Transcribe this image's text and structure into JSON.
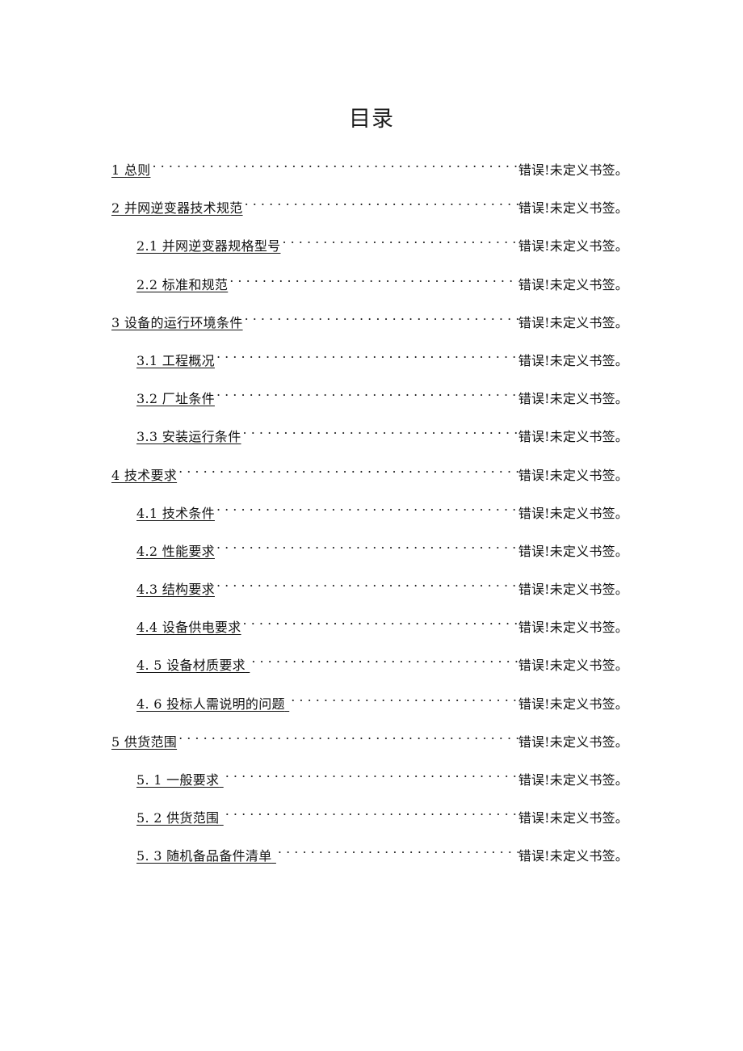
{
  "document": {
    "title": "目录",
    "page_background": "#ffffff",
    "text_color": "#111111"
  },
  "toc": {
    "leader_style": "dotted",
    "entries": [
      {
        "label": "1 总则",
        "level": 1,
        "page_ref": "错误!未定义书签。",
        "wide_number": false
      },
      {
        "label": "2 并网逆变器技术规范",
        "level": 1,
        "page_ref": "错误!未定义书签。",
        "wide_number": false
      },
      {
        "label": "2.1 并网逆变器规格型号",
        "level": 2,
        "page_ref": "错误!未定义书签。",
        "wide_number": false
      },
      {
        "label": "2.2 标准和规范",
        "level": 2,
        "page_ref": "错误!未定义书签。",
        "wide_number": false
      },
      {
        "label": "3 设备的运行环境条件",
        "level": 1,
        "page_ref": "错误!未定义书签。",
        "wide_number": false
      },
      {
        "label": "3.1 工程概况",
        "level": 2,
        "page_ref": "错误!未定义书签。",
        "wide_number": false
      },
      {
        "label": "3.2 厂址条件",
        "level": 2,
        "page_ref": "错误!未定义书签。",
        "wide_number": false
      },
      {
        "label": "3.3 安装运行条件",
        "level": 2,
        "page_ref": "错误!未定义书签。",
        "wide_number": false
      },
      {
        "label": "4 技术要求",
        "level": 1,
        "page_ref": "错误!未定义书签。",
        "wide_number": false
      },
      {
        "label": "4.1 技术条件",
        "level": 2,
        "page_ref": "错误!未定义书签。",
        "wide_number": false
      },
      {
        "label": "4.2 性能要求",
        "level": 2,
        "page_ref": "错误!未定义书签。",
        "wide_number": false
      },
      {
        "label": "4.3 结构要求",
        "level": 2,
        "page_ref": "错误!未定义书签。",
        "wide_number": false
      },
      {
        "label": "4.4 设备供电要求",
        "level": 2,
        "page_ref": "错误!未定义书签。",
        "wide_number": false
      },
      {
        "label": "4. 5 设备材质要求",
        "level": 2,
        "page_ref": "错误!未定义书签。",
        "wide_number": true
      },
      {
        "label": "4. 6 投标人需说明的问题",
        "level": 2,
        "page_ref": "错误!未定义书签。",
        "wide_number": true
      },
      {
        "label": "5 供货范围",
        "level": 1,
        "page_ref": "错误!未定义书签。",
        "wide_number": false
      },
      {
        "label": "5. 1 一般要求",
        "level": 2,
        "page_ref": "错误!未定义书签。",
        "wide_number": true
      },
      {
        "label": "5. 2 供货范围",
        "level": 2,
        "page_ref": "错误!未定义书签。",
        "wide_number": true
      },
      {
        "label": "5. 3 随机备品备件清单",
        "level": 2,
        "page_ref": "错误!未定义书签。",
        "wide_number": true
      }
    ]
  }
}
